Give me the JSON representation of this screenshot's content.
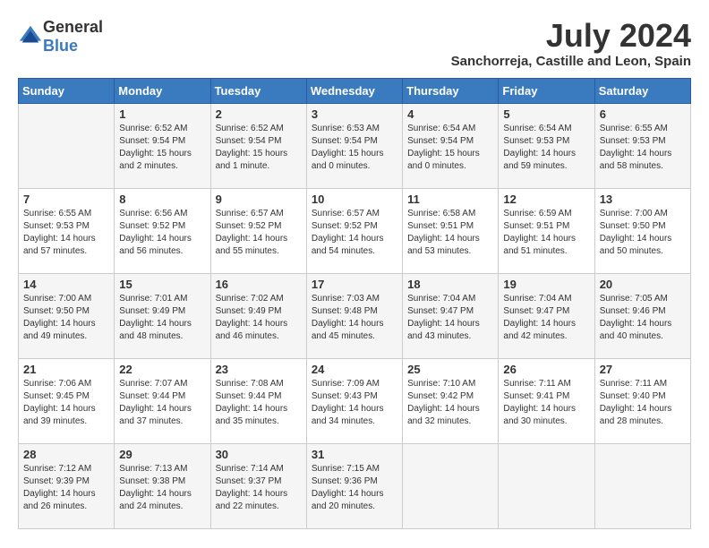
{
  "header": {
    "logo_general": "General",
    "logo_blue": "Blue",
    "month_year": "July 2024",
    "location": "Sanchorreja, Castille and Leon, Spain"
  },
  "days_of_week": [
    "Sunday",
    "Monday",
    "Tuesday",
    "Wednesday",
    "Thursday",
    "Friday",
    "Saturday"
  ],
  "weeks": [
    [
      {
        "day": "",
        "info": ""
      },
      {
        "day": "1",
        "info": "Sunrise: 6:52 AM\nSunset: 9:54 PM\nDaylight: 15 hours\nand 2 minutes."
      },
      {
        "day": "2",
        "info": "Sunrise: 6:52 AM\nSunset: 9:54 PM\nDaylight: 15 hours\nand 1 minute."
      },
      {
        "day": "3",
        "info": "Sunrise: 6:53 AM\nSunset: 9:54 PM\nDaylight: 15 hours\nand 0 minutes."
      },
      {
        "day": "4",
        "info": "Sunrise: 6:54 AM\nSunset: 9:54 PM\nDaylight: 15 hours\nand 0 minutes."
      },
      {
        "day": "5",
        "info": "Sunrise: 6:54 AM\nSunset: 9:53 PM\nDaylight: 14 hours\nand 59 minutes."
      },
      {
        "day": "6",
        "info": "Sunrise: 6:55 AM\nSunset: 9:53 PM\nDaylight: 14 hours\nand 58 minutes."
      }
    ],
    [
      {
        "day": "7",
        "info": "Sunrise: 6:55 AM\nSunset: 9:53 PM\nDaylight: 14 hours\nand 57 minutes."
      },
      {
        "day": "8",
        "info": "Sunrise: 6:56 AM\nSunset: 9:52 PM\nDaylight: 14 hours\nand 56 minutes."
      },
      {
        "day": "9",
        "info": "Sunrise: 6:57 AM\nSunset: 9:52 PM\nDaylight: 14 hours\nand 55 minutes."
      },
      {
        "day": "10",
        "info": "Sunrise: 6:57 AM\nSunset: 9:52 PM\nDaylight: 14 hours\nand 54 minutes."
      },
      {
        "day": "11",
        "info": "Sunrise: 6:58 AM\nSunset: 9:51 PM\nDaylight: 14 hours\nand 53 minutes."
      },
      {
        "day": "12",
        "info": "Sunrise: 6:59 AM\nSunset: 9:51 PM\nDaylight: 14 hours\nand 51 minutes."
      },
      {
        "day": "13",
        "info": "Sunrise: 7:00 AM\nSunset: 9:50 PM\nDaylight: 14 hours\nand 50 minutes."
      }
    ],
    [
      {
        "day": "14",
        "info": "Sunrise: 7:00 AM\nSunset: 9:50 PM\nDaylight: 14 hours\nand 49 minutes."
      },
      {
        "day": "15",
        "info": "Sunrise: 7:01 AM\nSunset: 9:49 PM\nDaylight: 14 hours\nand 48 minutes."
      },
      {
        "day": "16",
        "info": "Sunrise: 7:02 AM\nSunset: 9:49 PM\nDaylight: 14 hours\nand 46 minutes."
      },
      {
        "day": "17",
        "info": "Sunrise: 7:03 AM\nSunset: 9:48 PM\nDaylight: 14 hours\nand 45 minutes."
      },
      {
        "day": "18",
        "info": "Sunrise: 7:04 AM\nSunset: 9:47 PM\nDaylight: 14 hours\nand 43 minutes."
      },
      {
        "day": "19",
        "info": "Sunrise: 7:04 AM\nSunset: 9:47 PM\nDaylight: 14 hours\nand 42 minutes."
      },
      {
        "day": "20",
        "info": "Sunrise: 7:05 AM\nSunset: 9:46 PM\nDaylight: 14 hours\nand 40 minutes."
      }
    ],
    [
      {
        "day": "21",
        "info": "Sunrise: 7:06 AM\nSunset: 9:45 PM\nDaylight: 14 hours\nand 39 minutes."
      },
      {
        "day": "22",
        "info": "Sunrise: 7:07 AM\nSunset: 9:44 PM\nDaylight: 14 hours\nand 37 minutes."
      },
      {
        "day": "23",
        "info": "Sunrise: 7:08 AM\nSunset: 9:44 PM\nDaylight: 14 hours\nand 35 minutes."
      },
      {
        "day": "24",
        "info": "Sunrise: 7:09 AM\nSunset: 9:43 PM\nDaylight: 14 hours\nand 34 minutes."
      },
      {
        "day": "25",
        "info": "Sunrise: 7:10 AM\nSunset: 9:42 PM\nDaylight: 14 hours\nand 32 minutes."
      },
      {
        "day": "26",
        "info": "Sunrise: 7:11 AM\nSunset: 9:41 PM\nDaylight: 14 hours\nand 30 minutes."
      },
      {
        "day": "27",
        "info": "Sunrise: 7:11 AM\nSunset: 9:40 PM\nDaylight: 14 hours\nand 28 minutes."
      }
    ],
    [
      {
        "day": "28",
        "info": "Sunrise: 7:12 AM\nSunset: 9:39 PM\nDaylight: 14 hours\nand 26 minutes."
      },
      {
        "day": "29",
        "info": "Sunrise: 7:13 AM\nSunset: 9:38 PM\nDaylight: 14 hours\nand 24 minutes."
      },
      {
        "day": "30",
        "info": "Sunrise: 7:14 AM\nSunset: 9:37 PM\nDaylight: 14 hours\nand 22 minutes."
      },
      {
        "day": "31",
        "info": "Sunrise: 7:15 AM\nSunset: 9:36 PM\nDaylight: 14 hours\nand 20 minutes."
      },
      {
        "day": "",
        "info": ""
      },
      {
        "day": "",
        "info": ""
      },
      {
        "day": "",
        "info": ""
      }
    ]
  ]
}
